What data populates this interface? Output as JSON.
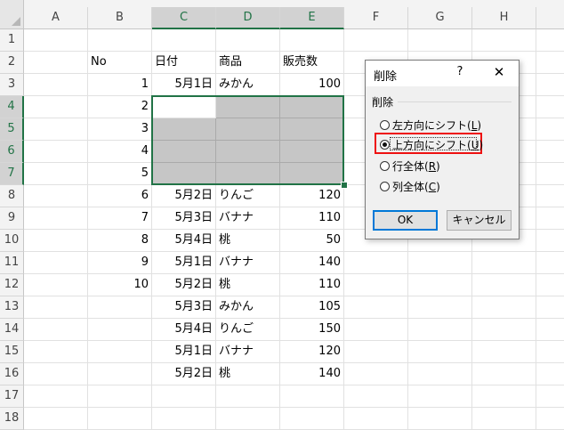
{
  "columns": [
    "A",
    "B",
    "C",
    "D",
    "E",
    "F",
    "G",
    "H"
  ],
  "rows": [
    "1",
    "2",
    "3",
    "4",
    "5",
    "6",
    "7",
    "8",
    "9",
    "10",
    "11",
    "12",
    "13",
    "14",
    "15",
    "16",
    "17",
    "18"
  ],
  "table": {
    "headers": {
      "no": "No",
      "date": "日付",
      "item": "商品",
      "sales": "販売数"
    },
    "records": [
      {
        "row": "3",
        "no": "1",
        "date": "5月1日",
        "item": "みかん",
        "sales": "100"
      },
      {
        "row": "4",
        "no": "2",
        "date": "",
        "item": "",
        "sales": ""
      },
      {
        "row": "5",
        "no": "3",
        "date": "",
        "item": "",
        "sales": ""
      },
      {
        "row": "6",
        "no": "4",
        "date": "",
        "item": "",
        "sales": ""
      },
      {
        "row": "7",
        "no": "5",
        "date": "",
        "item": "",
        "sales": ""
      },
      {
        "row": "8",
        "no": "6",
        "date": "5月2日",
        "item": "りんご",
        "sales": "120"
      },
      {
        "row": "9",
        "no": "7",
        "date": "5月3日",
        "item": "バナナ",
        "sales": "110"
      },
      {
        "row": "10",
        "no": "8",
        "date": "5月4日",
        "item": "桃",
        "sales": "50"
      },
      {
        "row": "11",
        "no": "9",
        "date": "5月1日",
        "item": "バナナ",
        "sales": "140"
      },
      {
        "row": "12",
        "no": "10",
        "date": "5月2日",
        "item": "桃",
        "sales": "110"
      },
      {
        "row": "13",
        "no": "",
        "date": "5月3日",
        "item": "みかん",
        "sales": "105"
      },
      {
        "row": "14",
        "no": "",
        "date": "5月4日",
        "item": "りんご",
        "sales": "150"
      },
      {
        "row": "15",
        "no": "",
        "date": "5月1日",
        "item": "バナナ",
        "sales": "120"
      },
      {
        "row": "16",
        "no": "",
        "date": "5月2日",
        "item": "桃",
        "sales": "140"
      }
    ]
  },
  "dialog": {
    "title": "削除",
    "help": "?",
    "close": "✕",
    "group_label": "削除",
    "options": [
      {
        "text": "左方向にシフト(",
        "key": "L",
        "end": ")",
        "selected": false
      },
      {
        "text": "上方向にシフト(",
        "key": "U",
        "end": ")",
        "selected": true
      },
      {
        "text": "行全体(",
        "key": "R",
        "end": ")",
        "selected": false
      },
      {
        "text": "列全体(",
        "key": "C",
        "end": ")",
        "selected": false
      }
    ],
    "ok_label": "OK",
    "cancel_label": "キャンセル"
  },
  "colors": {
    "accent": "#217346",
    "highlight": "#e11111",
    "shaded": "#c6c6c6",
    "ok_border": "#0078d7"
  }
}
